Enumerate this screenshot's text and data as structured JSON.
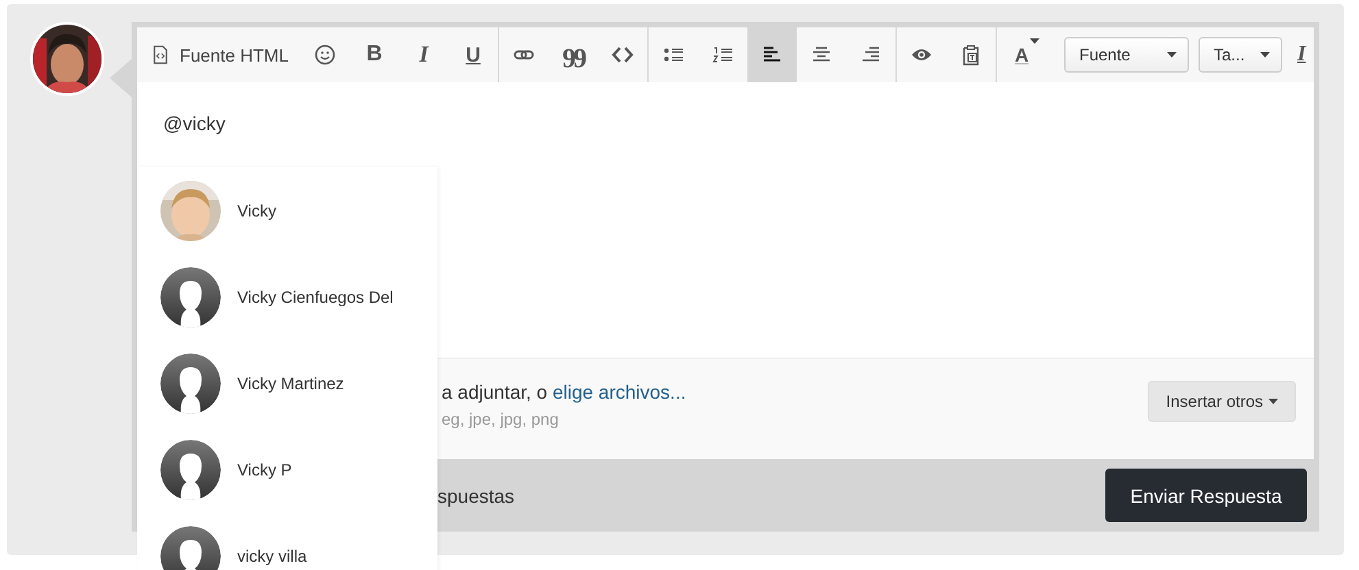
{
  "toolbar": {
    "groups": [
      {
        "items": [
          {
            "kind": "html-source",
            "label": "Fuente HTML",
            "selected": false
          },
          {
            "kind": "emoji",
            "selected": false
          },
          {
            "kind": "bold",
            "label": "B",
            "selected": false
          },
          {
            "kind": "italic",
            "label": "I",
            "selected": false
          },
          {
            "kind": "underline",
            "label": "U",
            "selected": false
          }
        ]
      },
      {
        "items": [
          {
            "kind": "link",
            "selected": false
          },
          {
            "kind": "quote",
            "label": "99",
            "selected": false
          },
          {
            "kind": "code",
            "selected": false
          }
        ]
      },
      {
        "items": [
          {
            "kind": "bullet-list",
            "selected": false
          },
          {
            "kind": "numbered-list",
            "selected": false
          },
          {
            "kind": "align-left",
            "selected": true
          },
          {
            "kind": "align-center",
            "selected": false
          },
          {
            "kind": "align-right",
            "selected": false
          }
        ]
      },
      {
        "items": [
          {
            "kind": "preview",
            "selected": false
          },
          {
            "kind": "paste-text",
            "selected": false
          }
        ]
      },
      {
        "items": [
          {
            "kind": "text-color",
            "label": "A",
            "selected": false
          },
          {
            "kind": "select",
            "label": "Fuente"
          },
          {
            "kind": "select",
            "label": "Ta..."
          },
          {
            "kind": "clear-format",
            "label": "I",
            "selected": false
          }
        ]
      }
    ]
  },
  "editor": {
    "text": "@vicky"
  },
  "mentions": [
    {
      "name": "Vicky"
    },
    {
      "name": "Vicky Cienfuegos Del",
      "kind": "default"
    },
    {
      "name": "Vicky Martinez",
      "kind": "default"
    },
    {
      "name": "Vicky P",
      "kind": "default"
    },
    {
      "name": "vicky villa",
      "kind": "default"
    }
  ],
  "attachments": {
    "text": "a adjuntar, o ",
    "link": "elige archivos...",
    "types": "eg, jpe, jpg, png",
    "button": "Insertar otros"
  },
  "footer": {
    "text": "spuestas",
    "button": "Enviar Respuesta"
  }
}
